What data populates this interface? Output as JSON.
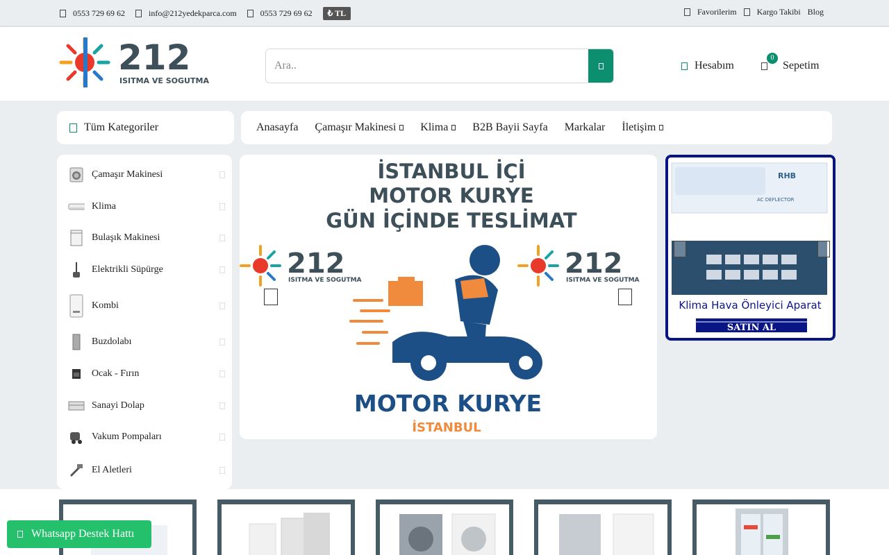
{
  "topbar": {
    "phone1": "0553 729 69 62",
    "email": "info@212yedekparca.com",
    "phone2": "0553 729 69 62",
    "currency": "₺ TL",
    "favorites": "Favorilerim",
    "cargo": "Kargo Takibi",
    "blog": "Blog"
  },
  "logo": {
    "number": "212",
    "tagline": "ISITMA VE SOGUTMA"
  },
  "search": {
    "placeholder": "Ara.."
  },
  "account": {
    "label": "Hesabım"
  },
  "cart": {
    "label": "Sepetim",
    "count": "0"
  },
  "categories_button": "Tüm Kategoriler",
  "menu": [
    {
      "label": "Anasayfa",
      "dropdown": false
    },
    {
      "label": "Çamaşır Makinesi",
      "dropdown": true
    },
    {
      "label": "Klima",
      "dropdown": true
    },
    {
      "label": "B2B Bayii Sayfa",
      "dropdown": false
    },
    {
      "label": "Markalar",
      "dropdown": false
    },
    {
      "label": "İletişim",
      "dropdown": true
    }
  ],
  "sidebar": {
    "items": [
      {
        "label": "Çamaşır Makinesi",
        "icon": "washing-machine-icon"
      },
      {
        "label": "Klima",
        "icon": "air-conditioner-icon"
      },
      {
        "label": "Bulaşık Makinesi",
        "icon": "dishwasher-icon"
      },
      {
        "label": "Elektrikli Süpürge",
        "icon": "vacuum-cleaner-icon"
      },
      {
        "label": "Kombi",
        "icon": "boiler-icon"
      },
      {
        "label": "Buzdolabı",
        "icon": "fridge-icon"
      },
      {
        "label": "Ocak - Fırın",
        "icon": "oven-icon"
      },
      {
        "label": "Sanayi Dolap",
        "icon": "industrial-fridge-icon"
      },
      {
        "label": "Vakum Pompaları",
        "icon": "vacuum-pump-icon"
      },
      {
        "label": "El Aletleri",
        "icon": "hand-tools-icon"
      }
    ]
  },
  "banner": {
    "line1": "İSTANBUL İÇİ",
    "line2": "MOTOR KURYE",
    "line3": "GÜN İÇİNDE TESLİMAT",
    "big": "MOTOR KURYE",
    "city": "İSTANBUL"
  },
  "promo": {
    "brand": "RHB",
    "product_text": "AC DEFLECTOR",
    "title": "Klima Hava Önleyici Aparat",
    "button": "SATIN AL"
  },
  "whatsapp": {
    "label": "Whatsapp Destek Hattı"
  },
  "colors": {
    "accent": "#0b8f6f",
    "promo_border": "#0a1585",
    "logo_text": "#3d4f59",
    "banner_blue": "#1c4f86",
    "banner_orange": "#f08a3c"
  }
}
